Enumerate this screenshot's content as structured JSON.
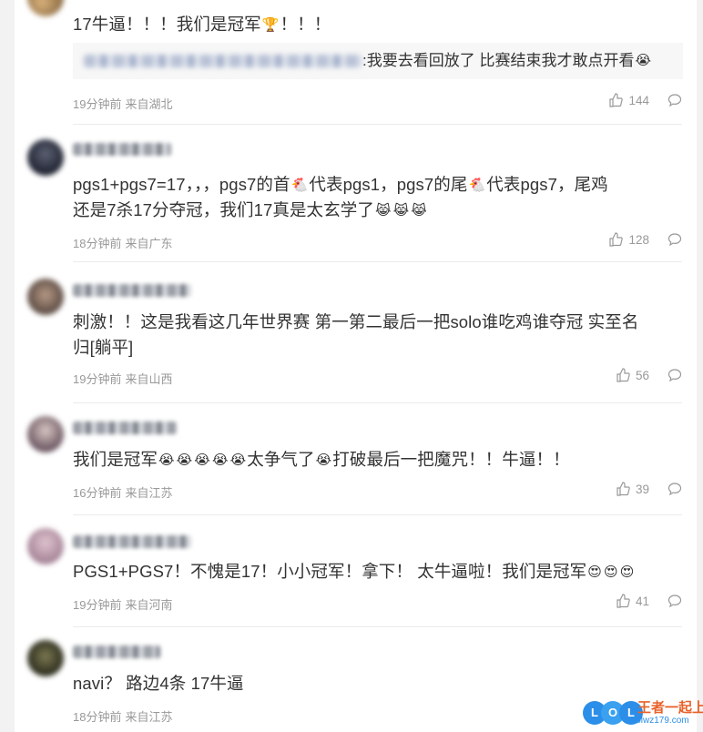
{
  "colors": {
    "background": "#f2f2f2",
    "panel": "#ffffff",
    "text": "#333333",
    "meta": "#999999",
    "accent": "#2b8ee8"
  },
  "comments": [
    {
      "text": "17牛逼！！！我们是冠军",
      "text_suffix": "！！！",
      "emoji": "trophy-emoji",
      "reply": {
        "text": ":我要去看回放了 比赛结束我才敢点开看",
        "emoji": "crying-face-emoji"
      },
      "time": "19分钟前",
      "location": "来自湖北",
      "likes": "144"
    },
    {
      "line1_parts": [
        "pgs1+pgs7=17，，，pgs7的首",
        "代表pgs1，pgs7的尾",
        "代表pgs7，尾鸡"
      ],
      "line2": "还是7杀17分夺冠，我们17真是太玄学了",
      "emojis": [
        "chicken-emoji",
        "laughing-cat-emoji"
      ],
      "time": "18分钟前",
      "location": "来自广东",
      "likes": "128"
    },
    {
      "line1": "刺激！！这是我看这几年世界赛 第一第二最后一把solo谁吃鸡谁夺冠 实至名",
      "line2": "归[躺平]",
      "time": "19分钟前",
      "location": "来自山西",
      "likes": "56"
    },
    {
      "text_parts": [
        "我们是冠军",
        "太争气了",
        "打破最后一把魔咒！！牛逼！！"
      ],
      "emoji": "crying-face-emoji",
      "time": "16分钟前",
      "location": "来自江苏",
      "likes": "39"
    },
    {
      "text": "PGS1+PGS7！不愧是17！小小冠军！拿下！ 太牛逼啦！我们是冠军",
      "emoji": "heart-eyes-emoji",
      "time": "19分钟前",
      "location": "来自河南",
      "likes": "41"
    },
    {
      "text": "navi？ 路边4条 17牛逼",
      "time": "18分钟前",
      "location": "来自江苏"
    }
  ],
  "watermark": {
    "logo": "LOL",
    "text": "王者一起上",
    "sub": "lolwz179.com"
  }
}
